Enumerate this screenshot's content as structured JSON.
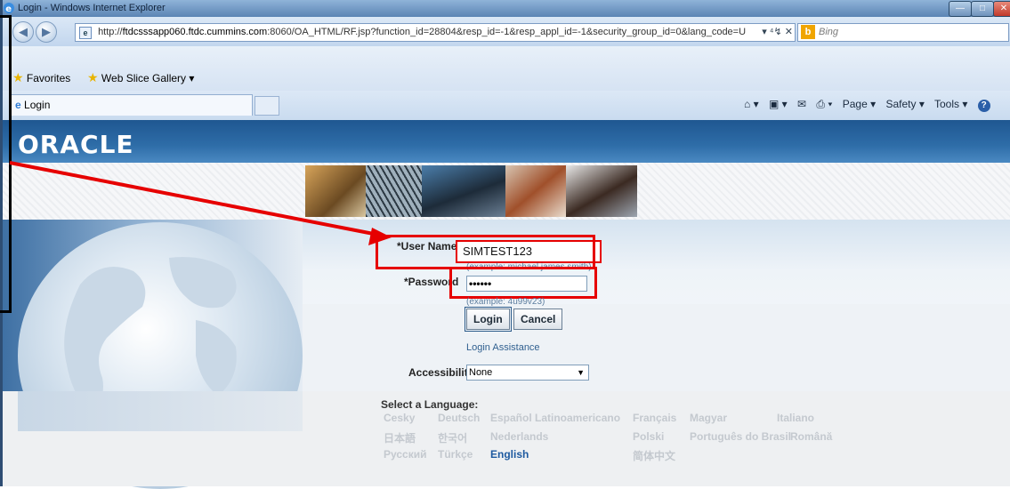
{
  "window": {
    "title": "Login - Windows Internet Explorer",
    "min_glyph": "—",
    "max_glyph": "□",
    "close_glyph": "✕"
  },
  "address_bar": {
    "url_prefix": "http://",
    "url_domain": "ftdcsssapp060.ftdc.cummins.com",
    "url_rest": ":8060/OA_HTML/RF.jsp?function_id=28804&resp_id=-1&resp_appl_id=-1&security_group_id=0&lang_code=U",
    "tools": "▾ ⁴↯ ✕",
    "search_placeholder": "Bing",
    "search_engine_logo": "b",
    "back_glyph": "◀",
    "forward_glyph": "▶"
  },
  "favorites_bar": {
    "favorites_label": "Favorites",
    "webslice_label": "Web Slice Gallery ▾"
  },
  "tabs": {
    "active_tab": "Login"
  },
  "command_bar": {
    "home": "⌂ ▾",
    "feeds": "▣ ▾",
    "mail": "✉",
    "print": "⎙ ▾",
    "page": "Page ▾",
    "safety": "Safety ▾",
    "tools": "Tools ▾",
    "help": "?"
  },
  "oracle": {
    "logo": "ORACLE"
  },
  "login_form": {
    "username_label": "*User Name",
    "username_value": "SIMTEST123",
    "username_example": "(example: michael.james.smith)",
    "password_label": "*Password",
    "password_value": "••••••",
    "password_example": "(example: 4u99v23)",
    "login_button": "Login",
    "cancel_button": "Cancel",
    "login_assistance": "Login Assistance",
    "accessibility_label": "Accessibility",
    "accessibility_value": "None",
    "accessibility_arrow": "▼"
  },
  "languages": {
    "title": "Select a Language:",
    "items": [
      "Cesky",
      "Deutsch",
      "Español Latinoamericano",
      "Français",
      "Magyar",
      "Italiano",
      "日本語",
      "한국어",
      "Nederlands",
      "Polski",
      "Português do Brasil",
      "Română",
      "Русский",
      "Türkçe",
      "English",
      "简体中文"
    ],
    "active": "English"
  },
  "colors": {
    "highlight": "#e60000",
    "oracle_banner": "#2e6da8",
    "active_language": "#1e5aa0"
  }
}
